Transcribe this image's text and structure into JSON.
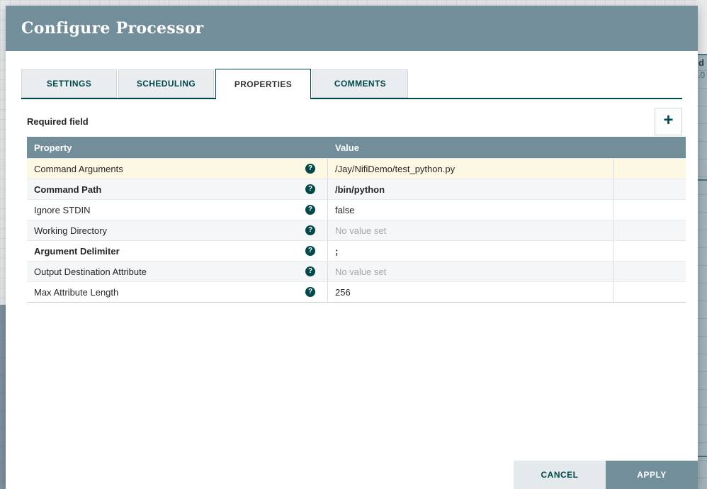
{
  "dialog": {
    "title": "Configure Processor",
    "tabs": [
      {
        "label": "SETTINGS",
        "active": false
      },
      {
        "label": "SCHEDULING",
        "active": false
      },
      {
        "label": "PROPERTIES",
        "active": true
      },
      {
        "label": "COMMENTS",
        "active": false
      }
    ],
    "required_field_label": "Required field",
    "table": {
      "columns": {
        "property": "Property",
        "value": "Value"
      },
      "rows": [
        {
          "property": "Command Arguments",
          "value": "/Jay/NifiDemo/test_python.py",
          "bold": false,
          "highlighted": true,
          "placeholder": false
        },
        {
          "property": "Command Path",
          "value": "/bin/python",
          "bold": true,
          "highlighted": false,
          "placeholder": false
        },
        {
          "property": "Ignore STDIN",
          "value": "false",
          "bold": false,
          "highlighted": false,
          "placeholder": false
        },
        {
          "property": "Working Directory",
          "value": "No value set",
          "bold": false,
          "highlighted": false,
          "placeholder": true
        },
        {
          "property": "Argument Delimiter",
          "value": ";",
          "bold": true,
          "highlighted": false,
          "placeholder": false
        },
        {
          "property": "Output Destination Attribute",
          "value": "No value set",
          "bold": false,
          "highlighted": false,
          "placeholder": true
        },
        {
          "property": "Max Attribute Length",
          "value": "256",
          "bold": false,
          "highlighted": false,
          "placeholder": false
        }
      ]
    },
    "buttons": {
      "cancel": "CANCEL",
      "apply": "APPLY"
    }
  },
  "icons": {
    "plus": "+",
    "help": "?"
  },
  "backdrop": {
    "fragment_text_1": "d",
    "fragment_text_2": ".0"
  },
  "colors": {
    "header_bg": "#728E9B",
    "accent_teal": "#004849",
    "highlighted_row_bg": "#FDF8E3",
    "even_row_bg": "#F4F6F8",
    "placeholder_text": "#A6A6A6",
    "apply_button_bg": "#728E9B",
    "cancel_button_bg": "#E4E9EC"
  }
}
